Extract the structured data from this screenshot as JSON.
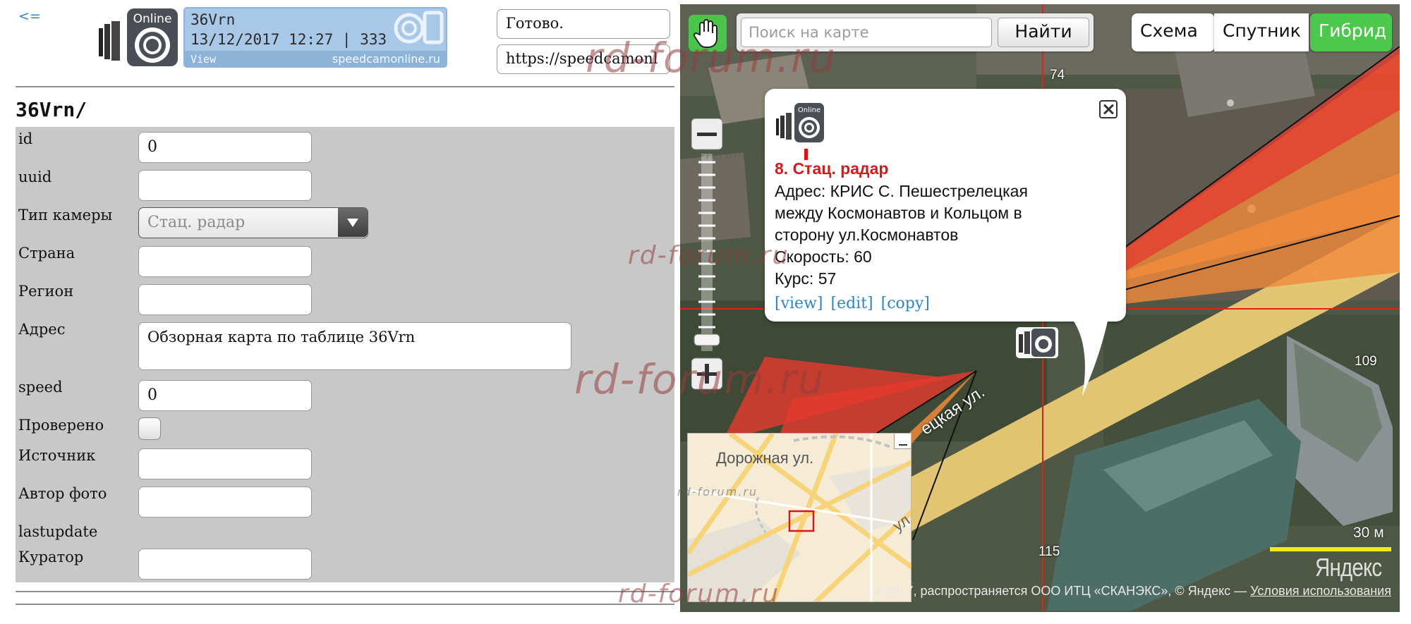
{
  "nav": {
    "back_link": "<="
  },
  "banner": {
    "name": "36Vrn",
    "date_count": "13/12/2017 12:27 | 333",
    "view": "View",
    "site": "speedcamonline.ru"
  },
  "status": {
    "text": "Готово.",
    "url": "https://speedcamonl"
  },
  "page_title": "36Vrn/",
  "form": {
    "id": {
      "label": "id",
      "value": "0"
    },
    "uuid": {
      "label": "uuid",
      "value": ""
    },
    "camera_type": {
      "label": "Тип камеры",
      "value": "Стац. радар"
    },
    "country": {
      "label": "Страна",
      "value": ""
    },
    "region": {
      "label": "Регион",
      "value": ""
    },
    "address": {
      "label": "Адрес",
      "value": "Обзорная карта по таблице 36Vrn"
    },
    "speed": {
      "label": "speed",
      "value": "0"
    },
    "checked": {
      "label": "Проверено",
      "checked": false
    },
    "source": {
      "label": "Источник",
      "value": ""
    },
    "photo_author": {
      "label": "Автор фото",
      "value": ""
    },
    "lastupdate": {
      "label": "lastupdate",
      "value": ""
    },
    "curator": {
      "label": "Куратор",
      "value": ""
    }
  },
  "map": {
    "search_placeholder": "Поиск на карте",
    "search_button": "Найти",
    "layers": {
      "scheme": "Схема",
      "satellite": "Спутник",
      "hybrid": "Гибрид",
      "active": "hybrid"
    },
    "balloon": {
      "title": "8. Стац. радар",
      "address_line1": "Адрес: КРИС С. Пешестрелецкая",
      "address_line2": "между Космонавтов и Кольцом в",
      "address_line3": "сторону ул.Космонавтов",
      "speed": "Скорость: 60",
      "course": "Курс: 57",
      "link_view": "[view]",
      "link_edit": "[edit]",
      "link_copy": "[copy]"
    },
    "street_label": "ецкая ул.",
    "house_numbers": [
      "74",
      "109",
      "115"
    ],
    "minimap": {
      "street1": "Дорожная ул.",
      "street2": "ул"
    },
    "scale": "30 м",
    "logo": "Яндекс",
    "copyright": "© 2017, распространяется ООО ИТЦ «СКАНЭКС», © Яндекс —",
    "terms_link": "Условия использования"
  },
  "watermark": "rd-forum.ru",
  "colors": {
    "link": "#2c86c9",
    "form_bg": "#c8c8c8",
    "hybrid_active": "#4cc94c",
    "balloon_title": "#d01c1c",
    "sector_red": "#e63a2e",
    "sector_orange": "#f08a3a",
    "road_yellow": "#f2d178"
  }
}
